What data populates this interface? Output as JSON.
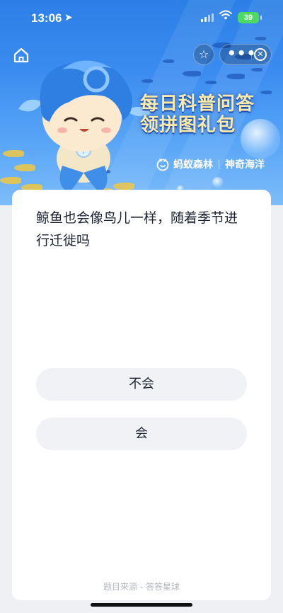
{
  "status_bar": {
    "time": "13:06",
    "battery": "39"
  },
  "banner": {
    "title_line1": "每日科普问答",
    "title_line2": "领拼图礼包",
    "brand": "蚂蚁森林",
    "tag": "神奇海洋"
  },
  "nav": {
    "more": "•••"
  },
  "question": {
    "text": "鲸鱼也会像鸟儿一样，随着季节进行迁徙吗"
  },
  "answers": [
    {
      "label": "不会"
    },
    {
      "label": "会"
    }
  ],
  "footer": {
    "source": "题目来源 - 答答星球"
  },
  "colors": {
    "accent": "#3b8cf0",
    "title_gold": "#ffe9a6",
    "battery_green": "#4cd964"
  }
}
